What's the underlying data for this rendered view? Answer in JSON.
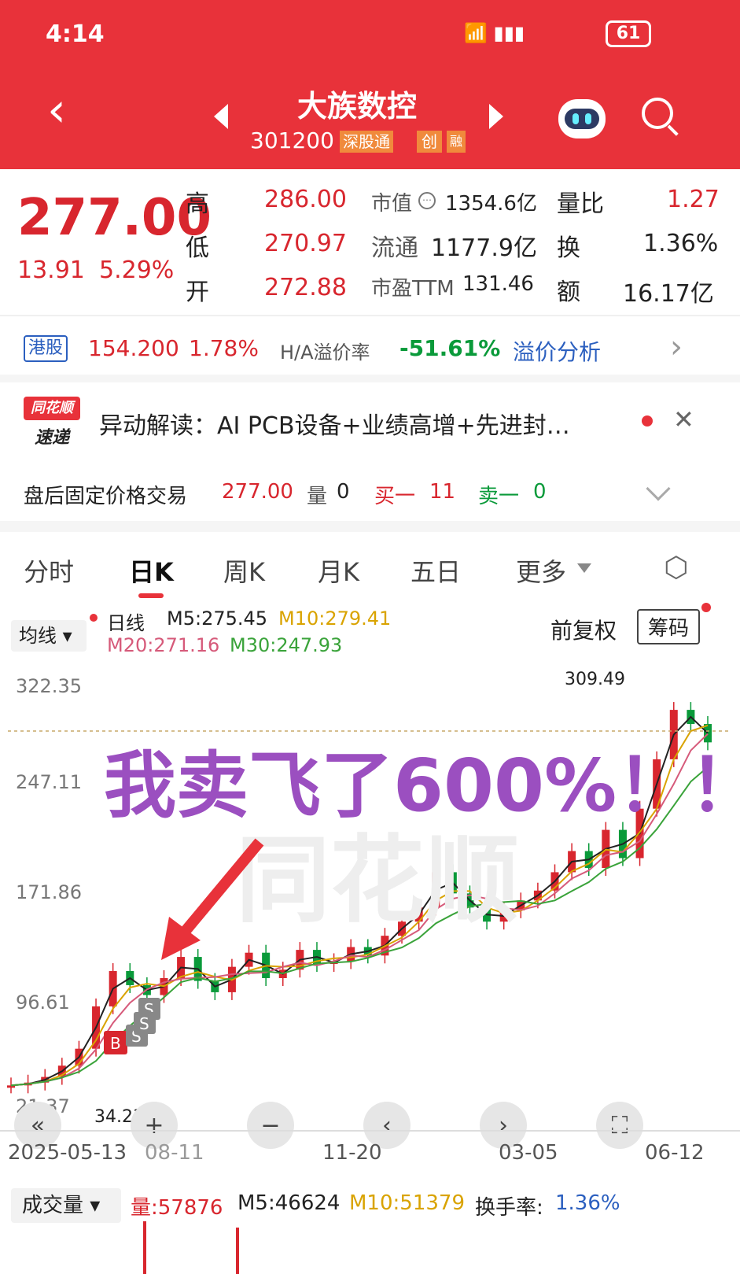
{
  "status_bar": {
    "time": "4:14",
    "battery": "61"
  },
  "header": {
    "title": "大族数控",
    "code": "301200",
    "tag1": "深股通",
    "tag2": "创",
    "tag3": "融",
    "bg": "#e8323a"
  },
  "quote": {
    "price": "277.00",
    "change": "13.91",
    "change_pct": "5.29%",
    "high_label": "高",
    "high": "286.00",
    "low_label": "低",
    "low": "270.97",
    "open_label": "开",
    "open": "272.88",
    "mcap_label": "市值",
    "mcap": "1354.6亿",
    "float_label": "流通",
    "float": "1177.9亿",
    "pe_label": "市盈TTM",
    "pe": "131.46",
    "vr_label": "量比",
    "vr": "1.27",
    "turn_label": "换",
    "turn": "1.36%",
    "amt_label": "额",
    "amt": "16.17亿"
  },
  "hk": {
    "badge": "港股",
    "price": "154.200",
    "pct": "1.78%",
    "premium_label": "H/A溢价率",
    "premium": "-51.61%",
    "analysis": "溢价分析"
  },
  "news": {
    "logo_top": "同花顺",
    "logo_bottom": "速递",
    "text": "异动解读：AI PCB设备+业绩高增+先进封…"
  },
  "after_hours": {
    "label": "盘后固定价格交易",
    "price": "277.00",
    "vol_label": "量",
    "vol": "0",
    "buy_label": "买一",
    "buy": "11",
    "sell_label": "卖一",
    "sell": "0"
  },
  "tabs": [
    "分时",
    "日K",
    "周K",
    "月K",
    "五日",
    "更多"
  ],
  "active_tab": 1,
  "legend": {
    "ma_select": "均线",
    "period": "日线",
    "m5": "M5:275.45",
    "m10": "M10:279.41",
    "m20": "M20:271.16",
    "m30": "M30:247.93",
    "adj": "前复权",
    "chip": "筹码"
  },
  "chart_data": {
    "type": "candlestick",
    "y_ticks": [
      "322.35",
      "247.11",
      "171.86",
      "96.61",
      "21.37"
    ],
    "x_ticks": [
      "2025-05-13",
      "08-11",
      "11-20",
      "03-05",
      "06-12"
    ],
    "max_label": "309.49",
    "min_label": "34.23",
    "watermark": "同花顺",
    "annotation": "我卖飞了600%！！",
    "markers": [
      "B",
      "S",
      "S",
      "S"
    ],
    "close_approx": [
      34,
      36,
      40,
      48,
      60,
      90,
      115,
      105,
      98,
      110,
      125,
      108,
      100,
      118,
      128,
      110,
      116,
      130,
      120,
      122,
      132,
      126,
      140,
      150,
      160,
      185,
      170,
      160,
      150,
      158,
      165,
      172,
      185,
      200,
      188,
      215,
      195,
      230,
      265,
      300,
      290,
      277
    ]
  },
  "controls": [
    "«",
    "+",
    "−",
    "‹",
    "›",
    "⛶"
  ],
  "volume": {
    "label": "成交量",
    "vol": "量:57876",
    "m5": "M5:46624",
    "m10": "M10:51379",
    "turn_label": "换手率:",
    "turn": "1.36%"
  }
}
